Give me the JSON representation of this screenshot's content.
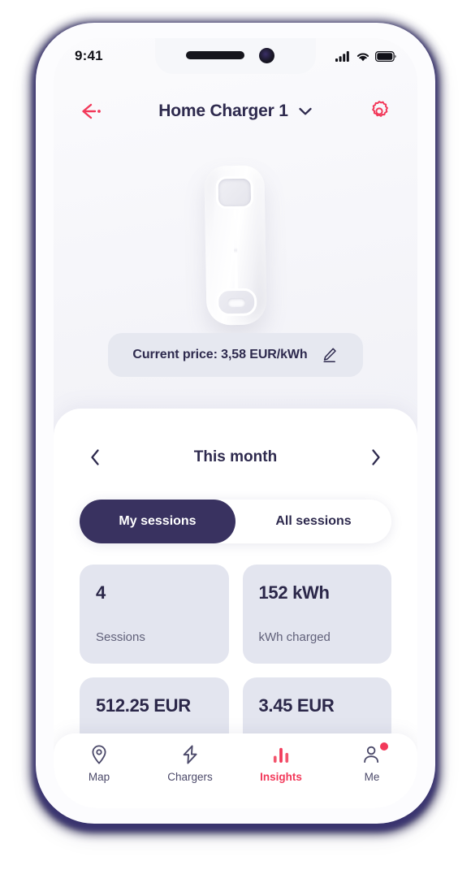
{
  "status_bar": {
    "time": "9:41",
    "signal_icon": "cellular-signal-icon",
    "wifi_icon": "wifi-icon",
    "battery_icon": "battery-full-icon"
  },
  "header": {
    "back_icon": "back-arrow-icon",
    "title": "Home Charger 1",
    "dropdown_icon": "chevron-down-icon",
    "settings_icon": "gear-icon"
  },
  "device": {
    "name": "ev-charger-device"
  },
  "price": {
    "text": "Current price: 3,58 EUR/kWh",
    "edit_icon": "pencil-edit-icon"
  },
  "period": {
    "prev_icon": "chevron-left-icon",
    "label": "This month",
    "next_icon": "chevron-right-icon"
  },
  "tabs": [
    {
      "label": "My sessions",
      "active": true
    },
    {
      "label": "All sessions",
      "active": false
    }
  ],
  "stats": [
    {
      "value": "4",
      "label": "Sessions"
    },
    {
      "value": "152 kWh",
      "label": "kWh charged"
    },
    {
      "value": "512.25 EUR",
      "label": ""
    },
    {
      "value": "3.45 EUR",
      "label": ""
    }
  ],
  "bottom_nav": [
    {
      "label": "Map",
      "icon": "map-pin-icon",
      "active": false,
      "badge": false
    },
    {
      "label": "Chargers",
      "icon": "lightning-bolt-icon",
      "active": false,
      "badge": false
    },
    {
      "label": "Insights",
      "icon": "bar-chart-icon",
      "active": true,
      "badge": false
    },
    {
      "label": "Me",
      "icon": "person-icon",
      "active": false,
      "badge": true
    }
  ],
  "colors": {
    "accent_red": "#f2395a",
    "navy": "#2e2a4e",
    "segment_active": "#393260",
    "card_grey": "#e3e5ef",
    "pill_grey": "#e6e8f0"
  }
}
